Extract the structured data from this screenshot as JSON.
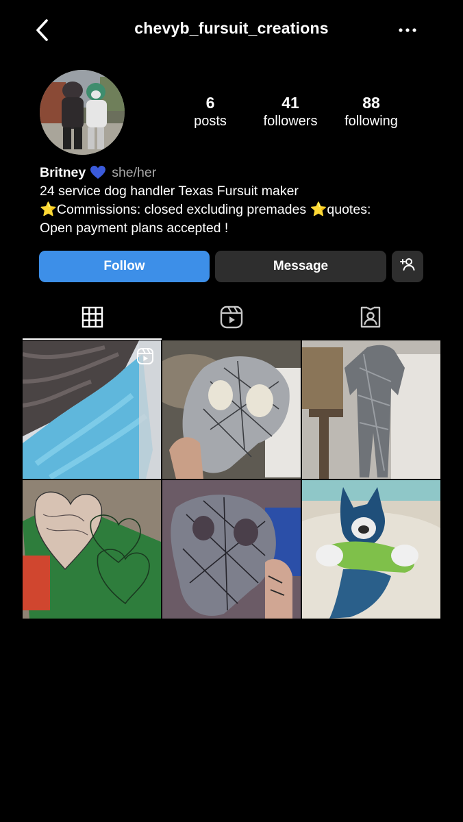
{
  "header": {
    "username": "chevyb_fursuit_creations",
    "back_icon": "chevron-left-icon",
    "more_icon": "more-horizontal-icon"
  },
  "profile": {
    "avatar_icon": "avatar",
    "stats": {
      "posts": {
        "value": "6",
        "label": "posts"
      },
      "followers": {
        "value": "41",
        "label": "followers"
      },
      "following": {
        "value": "88",
        "label": "following"
      }
    },
    "bio": {
      "name": "Britney",
      "pronouns": "she/her",
      "line1": "24 service dog handler Texas Fursuit maker",
      "line2_a": "⭐",
      "line2_b": "Commissions: closed excluding premades ",
      "line2_c": "⭐",
      "line2_d": "quotes:",
      "line3": "Open payment plans accepted !"
    }
  },
  "actions": {
    "follow_label": "Follow",
    "message_label": "Message",
    "suggest_icon": "add-person-icon"
  },
  "tabs": [
    {
      "name": "posts-grid",
      "icon": "grid-icon",
      "active": true
    },
    {
      "name": "reels",
      "icon": "reels-icon",
      "active": false
    },
    {
      "name": "tagged",
      "icon": "tagged-person-icon",
      "active": false
    }
  ],
  "colors": {
    "background": "#000000",
    "follow_button": "#3d8fe8",
    "secondary_button": "#2e2e2e",
    "heart": "#3b5bdb",
    "star": "#f8c93d",
    "muted_text": "#a8a8a8"
  },
  "posts": [
    {
      "name": "post-blue-fur",
      "reel": true
    },
    {
      "name": "post-taped-head-base",
      "reel": false
    },
    {
      "name": "post-duct-tape-bodysuit",
      "reel": false
    },
    {
      "name": "post-paper-heart-patterns",
      "reel": false
    },
    {
      "name": "post-tape-pattern-mask",
      "reel": false
    },
    {
      "name": "post-blue-green-fursuit-head",
      "reel": false
    }
  ]
}
